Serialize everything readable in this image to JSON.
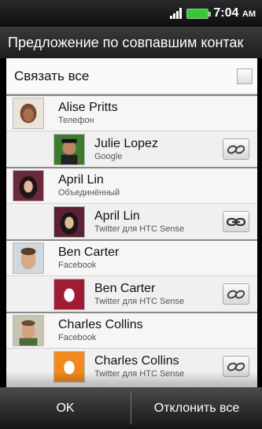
{
  "status": {
    "time": "7:04",
    "ampm": "AM"
  },
  "title": "Предложение по совпавшим контак",
  "link_all_label": "Связать все",
  "groups": [
    {
      "name": "Alise Pritts",
      "source": "Телефон",
      "child": {
        "name": "Julie Lopez",
        "source": "Google",
        "linked": false
      }
    },
    {
      "name": "April Lin",
      "source": "Объединённый",
      "child": {
        "name": "April Lin",
        "source": "Twitter для HTC Sense",
        "linked": true
      }
    },
    {
      "name": "Ben Carter",
      "source": "Facebook",
      "child": {
        "name": "Ben Carter",
        "source": "Twitter для HTC Sense",
        "linked": false
      }
    },
    {
      "name": "Charles Collins",
      "source": "Facebook",
      "child": {
        "name": "Charles Collins",
        "source": "Twitter для HTC Sense",
        "linked": false
      }
    }
  ],
  "buttons": {
    "ok": "OK",
    "reject_all": "Отклонить все"
  }
}
